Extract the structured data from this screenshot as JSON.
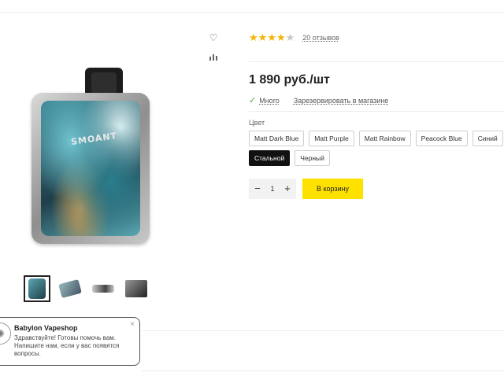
{
  "product": {
    "logo_text": "SMOANT",
    "rating_stars": 4,
    "rating_max": 5,
    "reviews": "20 отзывов",
    "price": "1 890 руб./шт",
    "stock_label": "Много",
    "reserve_label": "Зарезервировать в магазине",
    "color_label": "Цвет",
    "colors": [
      "Matt Dark Blue",
      "Matt Purple",
      "Matt Rainbow",
      "Peacock Blue",
      "Синий",
      "Стальной",
      "Черный"
    ],
    "selected_color": "Стальной",
    "quantity": "1",
    "cart_button": "В корзину"
  },
  "icons": {
    "wishlist": "heart-icon",
    "compare": "bar-chart-icon",
    "stock_check": "check-icon",
    "qty_minus": "minus-icon",
    "qty_plus": "plus-icon"
  },
  "colors_theme": {
    "star": "#f6b400",
    "check": "#5aa83b",
    "cart_button": "#ffe100",
    "selected_swatch": "#111111"
  },
  "chat": {
    "title": "Babylon Vapeshop",
    "message": "Здравствуйте! Готовы помочь вам. Напишите нам, если у вас появятся вопросы.",
    "close": "×"
  }
}
